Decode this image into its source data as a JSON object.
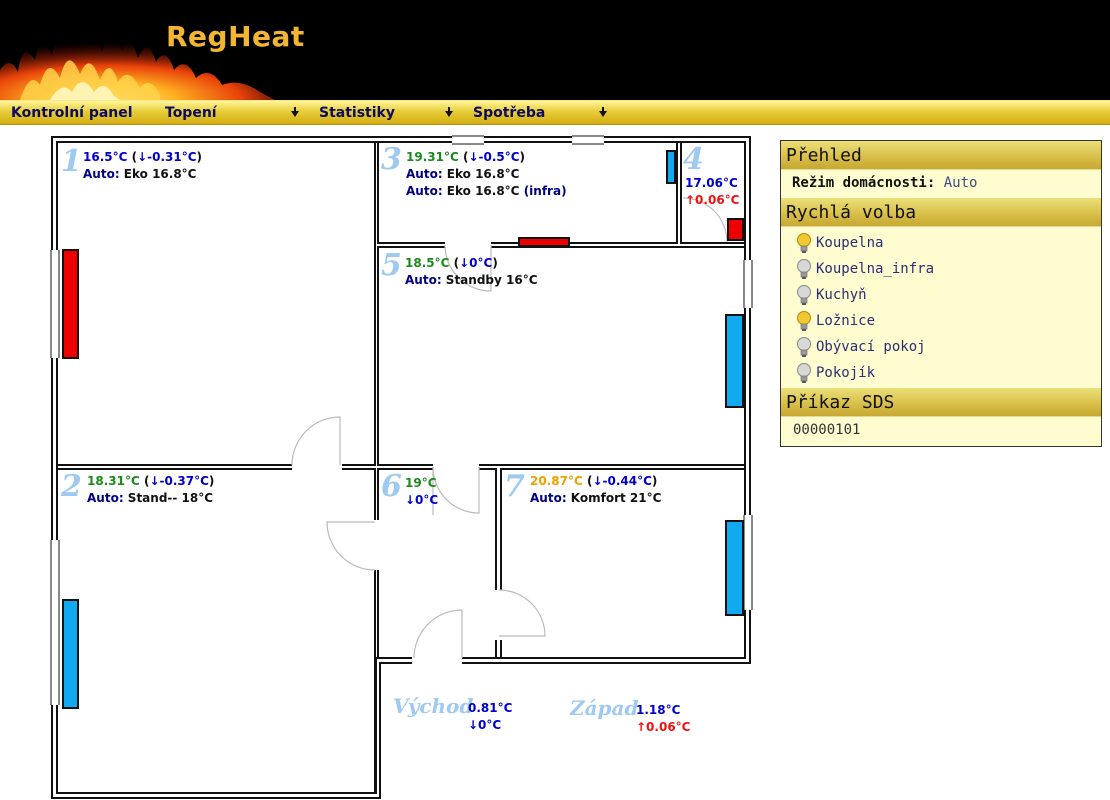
{
  "app": {
    "title": "RegHeat"
  },
  "menu": {
    "items": [
      {
        "label": "Kontrolní panel",
        "has_submenu": false
      },
      {
        "label": "Topení",
        "has_submenu": true
      },
      {
        "label": "Statistiky",
        "has_submenu": true
      },
      {
        "label": "Spotřeba",
        "has_submenu": true
      }
    ]
  },
  "rooms": [
    {
      "number": "1",
      "temp": "16.5°C",
      "trend": "↓-0.31°C",
      "mode_label": "Auto",
      "mode": "Eko 16.8°C",
      "radiator": "heating"
    },
    {
      "number": "2",
      "temp": "18.31°C",
      "trend": "↓-0.37°C",
      "mode_label": "Auto",
      "mode": "Stand-- 18°C",
      "radiator": "idle"
    },
    {
      "number": "3",
      "temp": "19.31°C",
      "trend": "↓-0.5°C",
      "mode_label": "Auto",
      "mode": "Eko 16.8°C",
      "mode2_label": "Auto",
      "mode2": "Eko 16.8°C",
      "mode2_note": "(infra)",
      "radiator": "idle",
      "radiator2": "heating"
    },
    {
      "number": "4",
      "temp": "17.06°C",
      "trend": "↑0.06°C",
      "radiator": "heating"
    },
    {
      "number": "5",
      "temp": "18.5°C",
      "trend": "↓0°C",
      "mode_label": "Auto",
      "mode": "Standby 16°C",
      "radiator": "idle"
    },
    {
      "number": "6",
      "temp": "19°C",
      "trend": "↓0°C"
    },
    {
      "number": "7",
      "temp": "20.87°C",
      "trend": "↓-0.44°C",
      "mode_label": "Auto",
      "mode": "Komfort 21°C",
      "radiator": "idle"
    }
  ],
  "outside": [
    {
      "label": "Východ",
      "temp": "0.81°C",
      "trend": "↓0°C"
    },
    {
      "label": "Západ",
      "temp": "1.18°C",
      "trend": "↑0.06°C"
    }
  ],
  "colors": {
    "heating": "#ee0000",
    "idle": "#11aaee",
    "temp_green": "#1b8a1b",
    "temp_orange": "#f0a000",
    "trend_down": "#0000cc",
    "trend_up": "#ee1111",
    "room_number": "#9ec9f0",
    "bulb_on": "#f2c830",
    "bulb_off": "#b8b8b8"
  },
  "panel": {
    "overview_title": "Přehled",
    "mode_key": "Režim domácnosti:",
    "mode_value": "Auto",
    "quick_title": "Rychlá volba",
    "quick_items": [
      {
        "label": "Koupelna",
        "on": true
      },
      {
        "label": "Koupelna_infra",
        "on": false
      },
      {
        "label": "Kuchyň",
        "on": false
      },
      {
        "label": "Ložnice",
        "on": true
      },
      {
        "label": "Obývací pokoj",
        "on": false
      },
      {
        "label": "Pokojík",
        "on": false
      }
    ],
    "command_title": "Příkaz SDS",
    "command_value": "00000101"
  }
}
